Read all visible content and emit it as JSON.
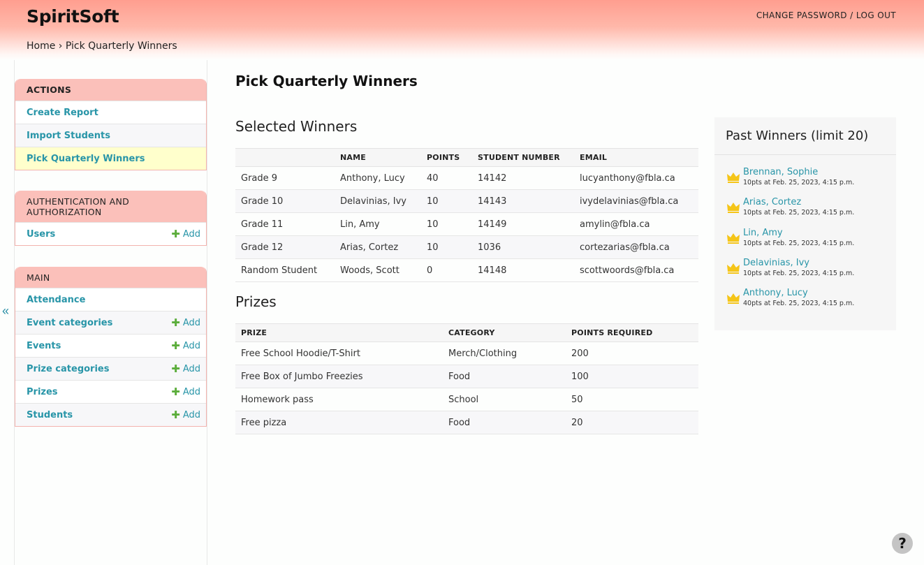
{
  "header": {
    "brand": "SpiritSoft",
    "change_password": "CHANGE PASSWORD",
    "separator": " / ",
    "log_out": "LOG OUT"
  },
  "breadcrumb": {
    "home": "Home",
    "sep": " › ",
    "current": "Pick Quarterly Winners"
  },
  "sidebar": {
    "collapse": "«",
    "actions": {
      "title": "ACTIONS",
      "items": [
        "Create Report",
        "Import Students",
        "Pick Quarterly Winners"
      ]
    },
    "auth": {
      "title": "AUTHENTICATION AND AUTHORIZATION",
      "items": [
        {
          "label": "Users",
          "add": "Add"
        }
      ]
    },
    "main": {
      "title": "MAIN",
      "items": [
        {
          "label": "Attendance",
          "add": ""
        },
        {
          "label": "Event categories",
          "add": "Add"
        },
        {
          "label": "Events",
          "add": "Add"
        },
        {
          "label": "Prize categories",
          "add": "Add"
        },
        {
          "label": "Prizes",
          "add": "Add"
        },
        {
          "label": "Students",
          "add": "Add"
        }
      ]
    }
  },
  "page_title": "Pick Quarterly Winners",
  "winners": {
    "title": "Selected Winners",
    "headers": [
      "",
      "NAME",
      "POINTS",
      "STUDENT NUMBER",
      "EMAIL"
    ],
    "rows": [
      [
        "Grade 9",
        "Anthony, Lucy",
        "40",
        "14142",
        "lucyanthony@fbla.ca"
      ],
      [
        "Grade 10",
        "Delavinias, Ivy",
        "10",
        "14143",
        "ivydelavinias@fbla.ca"
      ],
      [
        "Grade 11",
        "Lin, Amy",
        "10",
        "14149",
        "amylin@fbla.ca"
      ],
      [
        "Grade 12",
        "Arias, Cortez",
        "10",
        "1036",
        "cortezarias@fbla.ca"
      ],
      [
        "Random Student",
        "Woods, Scott",
        "0",
        "14148",
        "scottwoords@fbla.ca"
      ]
    ]
  },
  "prizes": {
    "title": "Prizes",
    "headers": [
      "PRIZE",
      "CATEGORY",
      "POINTS REQUIRED"
    ],
    "rows": [
      [
        "Free School Hoodie/T-Shirt",
        "Merch/Clothing",
        "200"
      ],
      [
        "Free Box of Jumbo Freezies",
        "Food",
        "100"
      ],
      [
        "Homework pass",
        "School",
        "50"
      ],
      [
        "Free pizza",
        "Food",
        "20"
      ]
    ]
  },
  "past_winners": {
    "title": "Past Winners (limit 20)",
    "icon": "crown-icon",
    "crown_color": "#f5c518",
    "items": [
      {
        "name": "Brennan, Sophie",
        "meta": "10pts at Feb. 25, 2023, 4:15 p.m."
      },
      {
        "name": "Arias, Cortez",
        "meta": "10pts at Feb. 25, 2023, 4:15 p.m."
      },
      {
        "name": "Lin, Amy",
        "meta": "10pts at Feb. 25, 2023, 4:15 p.m."
      },
      {
        "name": "Delavinias, Ivy",
        "meta": "10pts at Feb. 25, 2023, 4:15 p.m."
      },
      {
        "name": "Anthony, Lucy",
        "meta": "40pts at Feb. 25, 2023, 4:15 p.m."
      }
    ]
  },
  "help": "?"
}
